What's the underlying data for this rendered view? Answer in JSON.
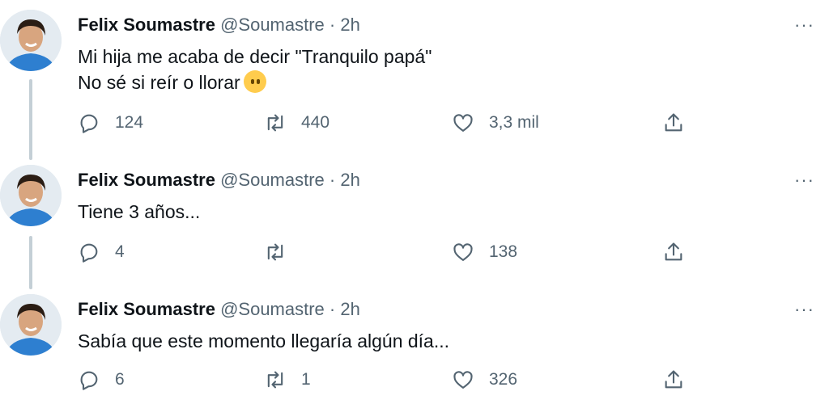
{
  "author": {
    "name": "Felix Soumastre",
    "handle": "@Soumastre",
    "separator": "·",
    "time": "2h",
    "more": "···"
  },
  "tweets": [
    {
      "lines": [
        "Mi hija me acaba de decir \"Tranquilo papá\"",
        "No sé si reír o llorar"
      ],
      "emoji": "face-without-mouth",
      "replies": "124",
      "retweets": "440",
      "likes": "3,3 mil"
    },
    {
      "lines": [
        "Tiene 3 años..."
      ],
      "replies": "4",
      "retweets": "",
      "likes": "138"
    },
    {
      "lines": [
        "Sabía que este momento llegaría algún día..."
      ],
      "replies": "6",
      "retweets": "1",
      "likes": "326"
    }
  ],
  "icons": {
    "reply": "reply-icon",
    "retweet": "retweet-icon",
    "like": "heart-icon",
    "share": "share-icon"
  },
  "colors": {
    "text": "#0f1419",
    "secondary": "#536471",
    "thread_line": "#c4cfd6"
  }
}
